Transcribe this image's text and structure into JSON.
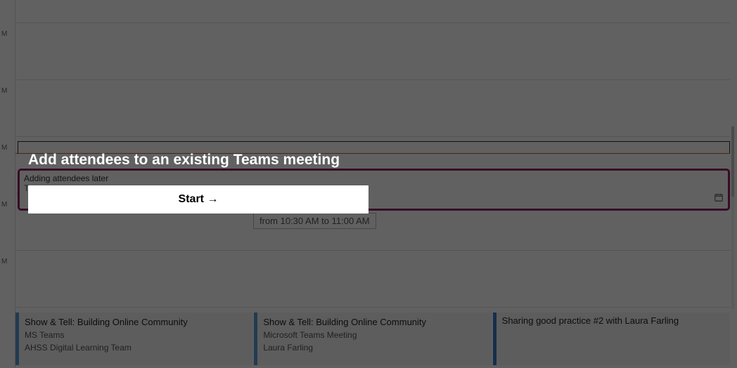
{
  "time_labels": [
    "M",
    "M",
    "M",
    "M",
    "M"
  ],
  "meeting": {
    "title": "Adding attendees later",
    "subject_prefix": "Te",
    "time_tooltip": "from 10:30 AM to 11:00 AM"
  },
  "events": [
    {
      "title": "Show & Tell: Building Online Community",
      "location": "MS Teams",
      "organizer": "AHSS Digital Learning Team"
    },
    {
      "title": "Show & Tell: Building Online Community",
      "location": "Microsoft Teams Meeting",
      "organizer": "Laura Farling"
    },
    {
      "title": "Sharing good practice #2 with Laura Farling",
      "location": "",
      "organizer": ""
    }
  ],
  "tutorial": {
    "heading": "Add attendees to an existing Teams meeting",
    "start_label": "Start →"
  }
}
